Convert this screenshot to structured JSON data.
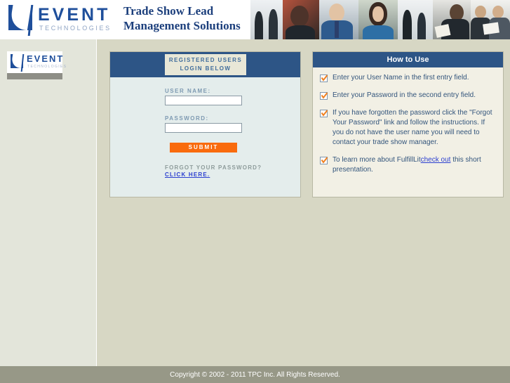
{
  "banner": {
    "logo": {
      "name": "EVENT",
      "sub": "TECHNOLOGIES",
      "mark": "event-swoosh-logo"
    },
    "tagline_line1": "Trade Show Lead",
    "tagline_line2": "Management Solutions",
    "photos": [
      "business-people-1",
      "business-people-2",
      "business-people-3",
      "business-people-4",
      "business-people-5",
      "business-people-6",
      "business-people-7"
    ]
  },
  "sidebar": {
    "logo": {
      "name": "EVENT",
      "sub": "TECHNOLOGIES"
    }
  },
  "login": {
    "head_line1": "REGISTERED USERS",
    "head_line2": "LOGIN BELOW",
    "username_label": "USER NAME:",
    "username_value": "",
    "username_placeholder": "",
    "password_label": "PASSWORD:",
    "password_value": "",
    "password_placeholder": "",
    "submit_label": "SUBMIT",
    "forgot_text": "FORGOT YOUR PASSWORD?",
    "forgot_link": "CLICK HERE."
  },
  "help": {
    "title": "How to Use",
    "items": [
      {
        "text": "Enter your User Name in the first entry field."
      },
      {
        "text": "Enter your Password in the second entry field."
      },
      {
        "text": "If you have forgotten the password click the \"Forgot Your Password\" link and follow the instructions. If you do not have the user name you will need to contact your trade show manager."
      },
      {
        "text_before": "To learn more about FulfillLit",
        "link": "check out",
        "text_after": "this short presentation."
      }
    ]
  },
  "footer": {
    "copyright": "Copyright © 2002 - 2011 TPC Inc. All Rights Reserved."
  },
  "colors": {
    "header_blue": "#2d5586",
    "accent_orange": "#f96b0d",
    "page_bg": "#d7d7c4",
    "panel_bg": "#e4edec",
    "footer_bg": "#979887",
    "link_blue": "#2b3fd0"
  }
}
